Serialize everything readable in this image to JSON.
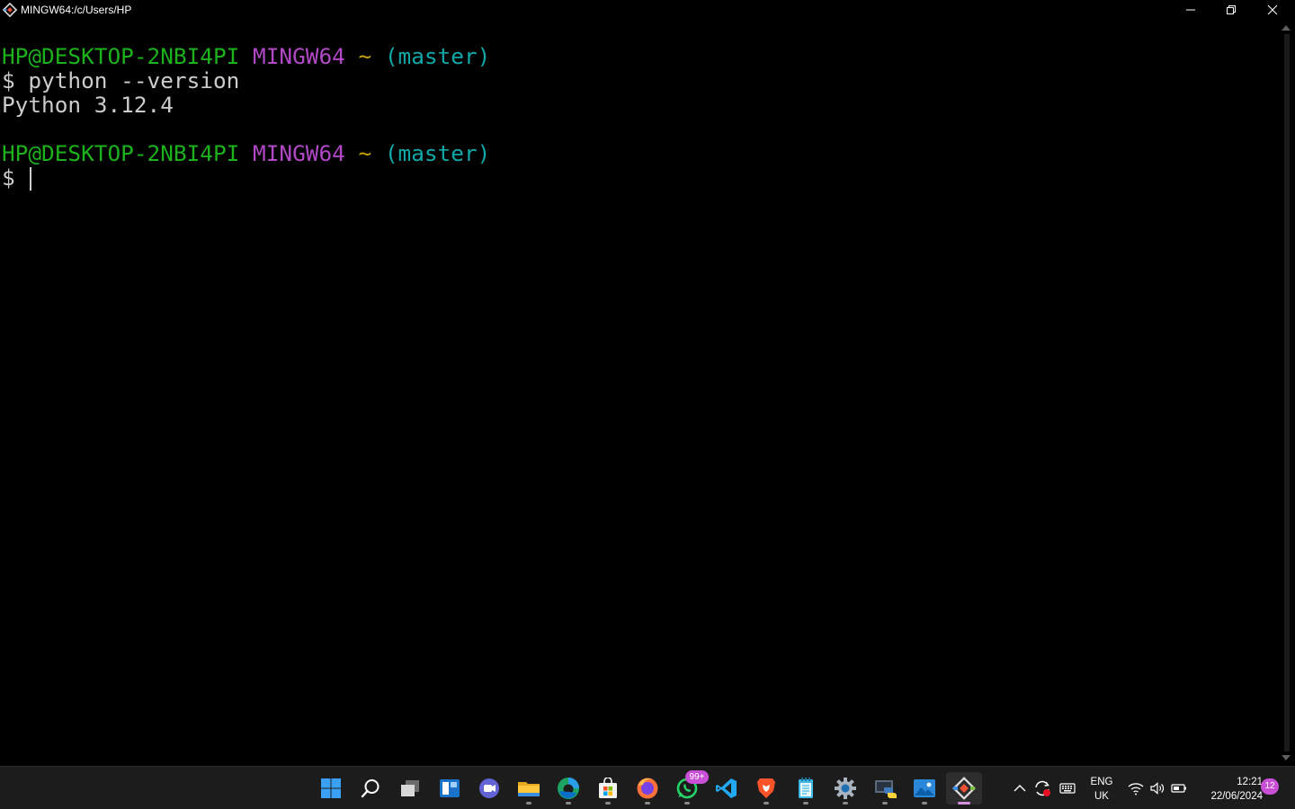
{
  "window": {
    "title": "MINGW64:/c/Users/HP",
    "icon": "git-bash-icon"
  },
  "terminal": {
    "blocks": [
      {
        "user_host": "HP@DESKTOP-2NBI4PI",
        "system": "MINGW64",
        "path": "~",
        "branch": "(master)",
        "prompt_symbol": "$",
        "command": "python --version",
        "output": "Python 3.12.4"
      },
      {
        "user_host": "HP@DESKTOP-2NBI4PI",
        "system": "MINGW64",
        "path": "~",
        "branch": "(master)",
        "prompt_symbol": "$",
        "command": ""
      }
    ],
    "colors": {
      "user_host": "#1cb21c",
      "system": "#b148c6",
      "path": "#c4a000",
      "branch": "#11a8a8",
      "text": "#cccccc"
    }
  },
  "taskbar": {
    "apps": [
      {
        "name": "start",
        "icon": "windows-start-icon"
      },
      {
        "name": "search",
        "icon": "search-icon"
      },
      {
        "name": "task-view",
        "icon": "task-view-icon"
      },
      {
        "name": "widgets",
        "icon": "widgets-icon"
      },
      {
        "name": "teams-chat",
        "icon": "chat-icon"
      },
      {
        "name": "file-explorer",
        "icon": "folder-icon"
      },
      {
        "name": "edge",
        "icon": "edge-icon"
      },
      {
        "name": "store",
        "icon": "store-icon"
      },
      {
        "name": "firefox",
        "icon": "firefox-icon"
      },
      {
        "name": "whatsapp",
        "icon": "whatsapp-icon",
        "badge": "99+"
      },
      {
        "name": "vscode",
        "icon": "vscode-icon"
      },
      {
        "name": "brave",
        "icon": "brave-icon"
      },
      {
        "name": "notepad",
        "icon": "notepad-icon"
      },
      {
        "name": "settings",
        "icon": "gear-icon"
      },
      {
        "name": "python",
        "icon": "python-icon"
      },
      {
        "name": "photos",
        "icon": "photos-icon"
      },
      {
        "name": "git-bash",
        "icon": "git-bash-icon",
        "active": true
      }
    ],
    "tray": {
      "language_line1": "ENG",
      "language_line2": "UK",
      "time": "12:21",
      "date": "22/06/2024",
      "notifications": "12"
    }
  }
}
